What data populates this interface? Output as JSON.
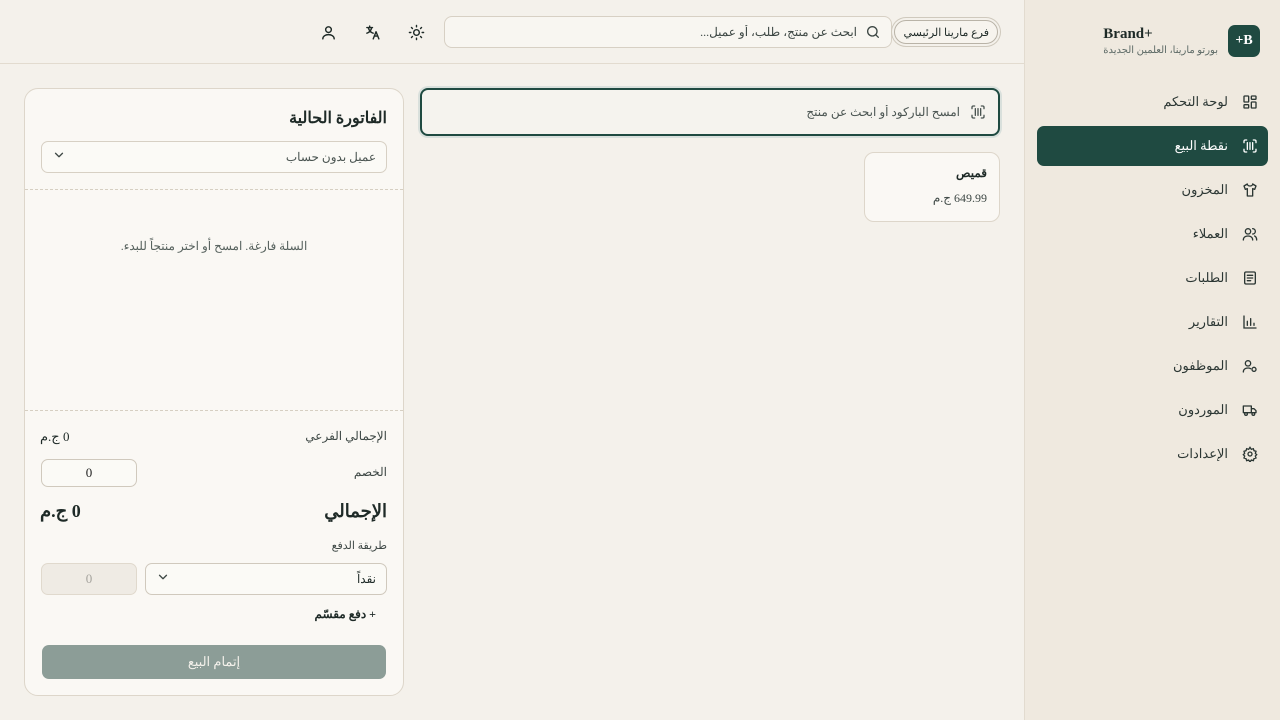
{
  "brand": {
    "logo_text": "B+",
    "name": "Brand+",
    "subtitle": "بورتو مارينا، العلمين الجديدة"
  },
  "nav": {
    "items": [
      {
        "label": "لوحة التحكم",
        "icon": "dashboard-icon",
        "active": false
      },
      {
        "label": "نقطة البيع",
        "icon": "barcode-scan-icon",
        "active": true
      },
      {
        "label": "المخزون",
        "icon": "shirt-icon",
        "active": false
      },
      {
        "label": "العملاء",
        "icon": "users-icon",
        "active": false
      },
      {
        "label": "الطلبات",
        "icon": "clipboard-icon",
        "active": false
      },
      {
        "label": "التقارير",
        "icon": "bar-chart-icon",
        "active": false
      },
      {
        "label": "الموظفون",
        "icon": "user-cog-icon",
        "active": false
      },
      {
        "label": "الموردون",
        "icon": "truck-icon",
        "active": false
      },
      {
        "label": "الإعدادات",
        "icon": "gear-icon",
        "active": false
      }
    ]
  },
  "topbar": {
    "branch": "فرع مارينا الرئيسي",
    "search_placeholder": "ابحث عن منتج، طلب، أو عميل..."
  },
  "scan": {
    "placeholder": "امسح الباركود أو ابحث عن منتج"
  },
  "products": [
    {
      "name": "قميص",
      "price": "649.99 ج.م"
    }
  ],
  "invoice": {
    "title": "الفاتورة الحالية",
    "customer": "عميل بدون حساب",
    "empty_message": "السلة فارغة. امسح أو اختر منتجاً للبدء.",
    "subtotal_label": "الإجمالي الفرعي",
    "subtotal_value": "0 ج.م",
    "discount_label": "الخصم",
    "discount_value": "0",
    "total_label": "الإجمالي",
    "total_value": "0 ج.م",
    "payment_method_label": "طريقة الدفع",
    "payment_method": "نقداً",
    "payment_amount": "0",
    "split_payment_label": "+ دفع مقسّم",
    "complete_label": "إتمام البيع"
  },
  "colors": {
    "primary": "#1f4a41",
    "background": "#f4f1eb",
    "sidebar": "#efe9df",
    "button_disabled": "#8c9d97"
  }
}
